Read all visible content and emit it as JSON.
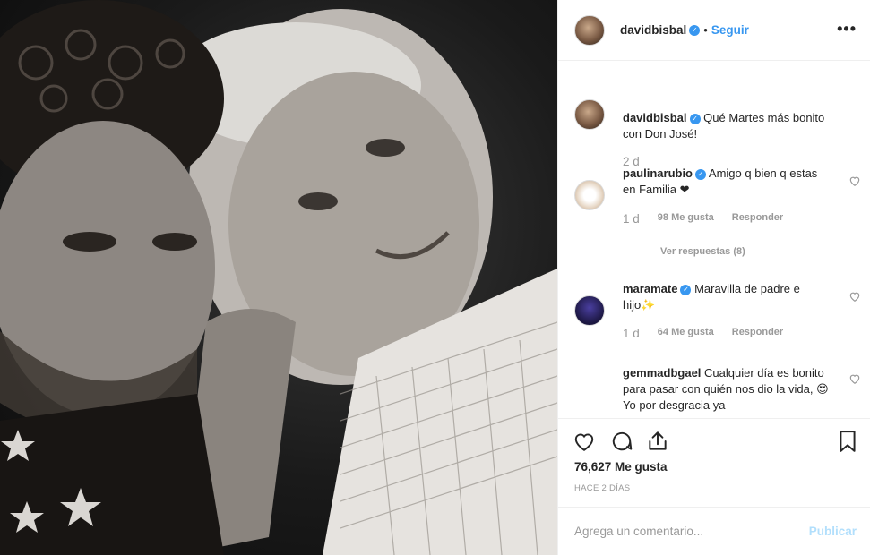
{
  "post": {
    "username": "davidbisbal",
    "follow_label": "Seguir",
    "dot": "•",
    "more_label": "•••"
  },
  "caption": {
    "username": "davidbisbal",
    "text": "Qué Martes más bonito con Don José!",
    "age": "2 d"
  },
  "comments": [
    {
      "username": "paulinarubio",
      "text": "Amigo q bien q estas en Familia ❤",
      "age": "1 d",
      "likes": "98 Me gusta",
      "reply": "Responder",
      "view_replies": "Ver respuestas (8)"
    },
    {
      "username": "maramate",
      "text": "Maravilla de padre e hijo✨",
      "age": "1 d",
      "likes": "64 Me gusta",
      "reply": "Responder"
    },
    {
      "username": "gemmadbgael",
      "text": "Cualquier día es bonito para pasar con quién nos dio la vida, 😍 Yo por desgracia ya"
    }
  ],
  "stats": {
    "likes": "76,627 Me gusta",
    "posted": "HACE 2 DÍAS"
  },
  "composer": {
    "placeholder": "Agrega un comentario...",
    "publish_label": "Publicar"
  },
  "colors": {
    "accent": "#3897f0",
    "publish_disabled": "#b2dffc",
    "muted": "#999999"
  }
}
